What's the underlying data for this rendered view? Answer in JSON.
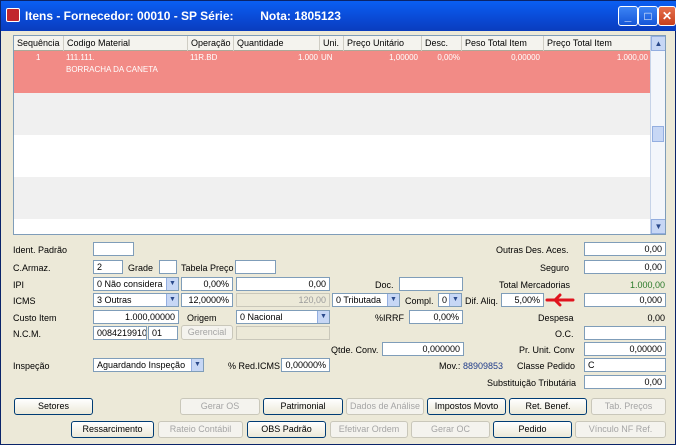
{
  "window": {
    "title": "Itens - Fornecedor: 00010 - SP Série:        Nota: 1805123"
  },
  "grid": {
    "headers": [
      "Sequência",
      "Codigo Material",
      "Operação",
      "Quantidade",
      "Uni.",
      "Preço Unitário",
      "Desc.",
      "Peso Total Item",
      "Preço Total Item"
    ],
    "row": {
      "seq": "1",
      "codigo": "111.111.",
      "descricao": "BORRACHA DA CANETA",
      "operacao": "11R.BD",
      "quantidade": "1.000",
      "uni": "UN",
      "preco_unitario": "1,00000",
      "desc": "0,00%",
      "peso_total": "0,00000",
      "preco_total": "1.000,00"
    }
  },
  "form": {
    "ident_padrao": {
      "label": "Ident. Padrão",
      "value": ""
    },
    "c_armaz": {
      "label": "C.Armaz.",
      "value": "2"
    },
    "grade": {
      "label": "Grade",
      "value": ""
    },
    "tabela_preco": {
      "label": "Tabela Preço",
      "value": ""
    },
    "ipi": {
      "label": "IPI",
      "select": "0 Não considera",
      "perc": "0,00%",
      "valor": "0,00"
    },
    "doc": {
      "label": "Doc.",
      "value": ""
    },
    "icms": {
      "label": "ICMS",
      "select": "3 Outras",
      "perc": "12,0000%",
      "valor": "120,00",
      "tributada": "0 Tributada"
    },
    "compl": {
      "label": "Compl.",
      "value": "0"
    },
    "dif_aliq": {
      "label": "Dif. Aliq.",
      "value": "5,00%"
    },
    "custo_item": {
      "label": "Custo Item",
      "value": "1.000,00000"
    },
    "origem": {
      "label": "Origem",
      "value": "0 Nacional"
    },
    "irrf": {
      "label": "%IRRF",
      "value": "0,00%"
    },
    "ncm": {
      "label": "N.C.M.",
      "value": "0084219910",
      "ex": "01",
      "gerencial": "Gerencial"
    },
    "qtde_conv": {
      "label": "Qtde. Conv.",
      "value": "0,000000"
    },
    "inspecao": {
      "label": "Inspeção",
      "value": "Aguardando Inspeção"
    },
    "red_icms": {
      "label": "% Red.ICMS",
      "value": "0,00000%"
    },
    "mov": {
      "label": "Mov.:",
      "value": "88909853"
    }
  },
  "right": {
    "outras_des": {
      "label": "Outras Des. Aces.",
      "value": "0,00"
    },
    "seguro": {
      "label": "Seguro",
      "value": "0,00"
    },
    "total_mercadorias": {
      "label": "Total Mercadorias",
      "value": "1.000,00"
    },
    "dif_value": "0,000",
    "despesa": {
      "label": "Despesa",
      "value": "0,00"
    },
    "oc": {
      "label": "O.C.",
      "value": ""
    },
    "pr_unit_conv": {
      "label": "Pr. Unit. Conv",
      "value": "0,00000"
    },
    "classe_pedido": {
      "label": "Classe Pedido",
      "value": "C"
    },
    "subst_trib": {
      "label": "Substituição Tributária",
      "value": "0,00"
    }
  },
  "buttons": {
    "setores": "Setores",
    "gerar_os": "Gerar OS",
    "patrimonial": "Patrimonial",
    "dados_analise": "Dados de Análise",
    "impostos_movto": "Impostos Movto",
    "ret_benef": "Ret. Benef.",
    "tab_precos": "Tab. Preços",
    "ressarcimento": "Ressarcimento",
    "rateio_contabil": "Rateio Contábil",
    "obs_padrao": "OBS Padrão",
    "efetivar_ordem": "Efetivar Ordem",
    "gerar_oc": "Gerar OC",
    "pedido": "Pedido",
    "vinculo_nf_ref": "Vínculo NF Ref."
  },
  "colors": {
    "selected_row": "#f28b86",
    "titlebar": "#0a49d4",
    "arrow": "#e0141e"
  }
}
